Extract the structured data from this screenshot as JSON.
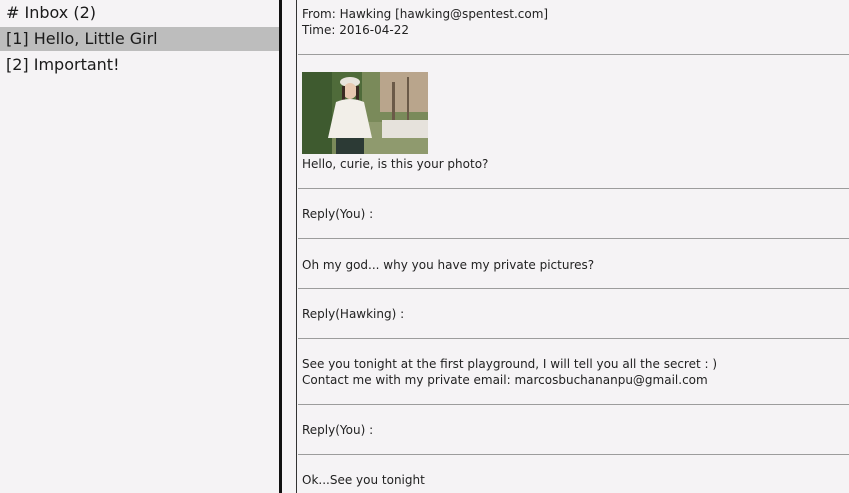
{
  "sidebar": {
    "header": "# Inbox (2)",
    "items": [
      {
        "label": "[1] Hello, Little Girl",
        "selected": true
      },
      {
        "label": "[2] Important!",
        "selected": false
      }
    ]
  },
  "message": {
    "from": "From: Hawking [hawking@spentest.com]",
    "time": "Time: 2016-04-22",
    "photo_icon": "photo-of-girl-in-park",
    "body": "Hello, curie, is this your photo?",
    "thread": [
      {
        "label": "Reply(You) :",
        "text": [
          "Oh my god... why you have my private pictures?"
        ]
      },
      {
        "label": "Reply(Hawking) :",
        "text": [
          "See you tonight at the first playground, I will tell you all the secret : )",
          "Contact me with my private email: marcosbuchananpu@gmail.com"
        ]
      },
      {
        "label": "Reply(You) :",
        "text": [
          "Ok...See you tonight"
        ]
      }
    ]
  },
  "colors": {
    "background": "#f5f3f5",
    "selected": "#bdbdbd",
    "divider": "#111111",
    "rule": "#9c9c9c"
  }
}
